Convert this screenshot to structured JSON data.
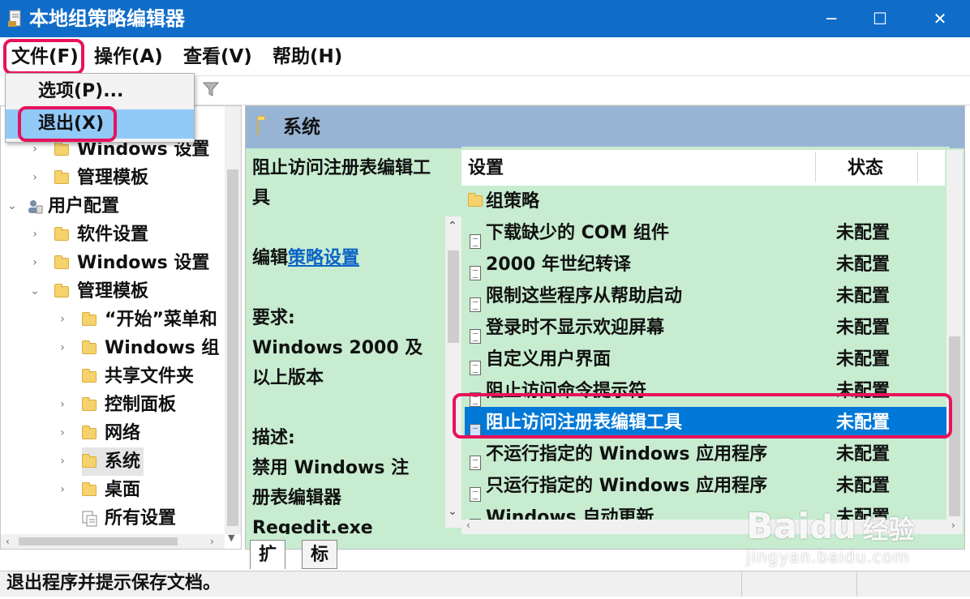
{
  "window": {
    "title": "本地组策略编辑器",
    "controls": {
      "minimize": "─",
      "maximize": "☐",
      "close": "✕"
    }
  },
  "menubar": [
    {
      "label": "文件(F)"
    },
    {
      "label": "操作(A)"
    },
    {
      "label": "查看(V)"
    },
    {
      "label": "帮助(H)"
    }
  ],
  "file_menu": [
    {
      "label": "选项(P)..."
    },
    {
      "label": "退出(X)"
    }
  ],
  "tree": [
    {
      "label": "Windows 设置",
      "chevron": "›"
    },
    {
      "label": "管理模板",
      "chevron": "›"
    },
    {
      "label": "用户配置",
      "chevron": "⌄"
    },
    {
      "label": "软件设置",
      "chevron": "›"
    },
    {
      "label": "Windows 设置",
      "chevron": "›"
    },
    {
      "label": "管理模板",
      "chevron": "⌄"
    },
    {
      "label": "“开始”菜单和",
      "chevron": "›"
    },
    {
      "label": "Windows 组",
      "chevron": "›"
    },
    {
      "label": "共享文件夹",
      "chevron": ""
    },
    {
      "label": "控制面板",
      "chevron": "›"
    },
    {
      "label": "网络",
      "chevron": "›"
    },
    {
      "label": "系统",
      "chevron": "›"
    },
    {
      "label": "桌面",
      "chevron": "›"
    },
    {
      "label": "所有设置",
      "chevron": ""
    }
  ],
  "right_header": {
    "title": "系统"
  },
  "description": {
    "lines": [
      "阻止访问注册表编辑工",
      "具",
      "",
      "编辑",
      "",
      "要求:",
      "Windows 2000 及",
      "以上版本",
      "",
      "描述:",
      "禁用 Windows 注",
      "册表编辑器",
      "Regedit.exe"
    ],
    "link_text": "策略设置"
  },
  "columns": {
    "setting": "设置",
    "state": "状态"
  },
  "rows": [
    {
      "name": "组策略",
      "state": "",
      "type": "folder"
    },
    {
      "name": "下载缺少的 COM 组件",
      "state": "未配置"
    },
    {
      "name": "2000 年世纪转译",
      "state": "未配置"
    },
    {
      "name": "限制这些程序从帮助启动",
      "state": "未配置"
    },
    {
      "name": "登录时不显示欢迎屏幕",
      "state": "未配置"
    },
    {
      "name": "自定义用户界面",
      "state": "未配置"
    },
    {
      "name": "阻止访问命令提示符",
      "state": "未配置"
    },
    {
      "name": "阻止访问注册表编辑工具",
      "state": "未配置",
      "selected": true
    },
    {
      "name": "不运行指定的 Windows 应用程序",
      "state": "未配置"
    },
    {
      "name": "只运行指定的 Windows 应用程序",
      "state": "未配置"
    },
    {
      "name": "Windows 自动更新",
      "state": "未配置"
    }
  ],
  "tabs": [
    {
      "label": "扩展"
    },
    {
      "label": "标准"
    }
  ],
  "status": "退出程序并提示保存文档。",
  "watermark": {
    "brand": "Bai",
    "paw": "du",
    "cn": "经验",
    "url": "jingyan.baidu.com"
  },
  "colors": {
    "titlebar": "#0f6cc9",
    "highlight": "#e8125c",
    "selection": "#0078d7",
    "pane": "#c7ecd0"
  }
}
